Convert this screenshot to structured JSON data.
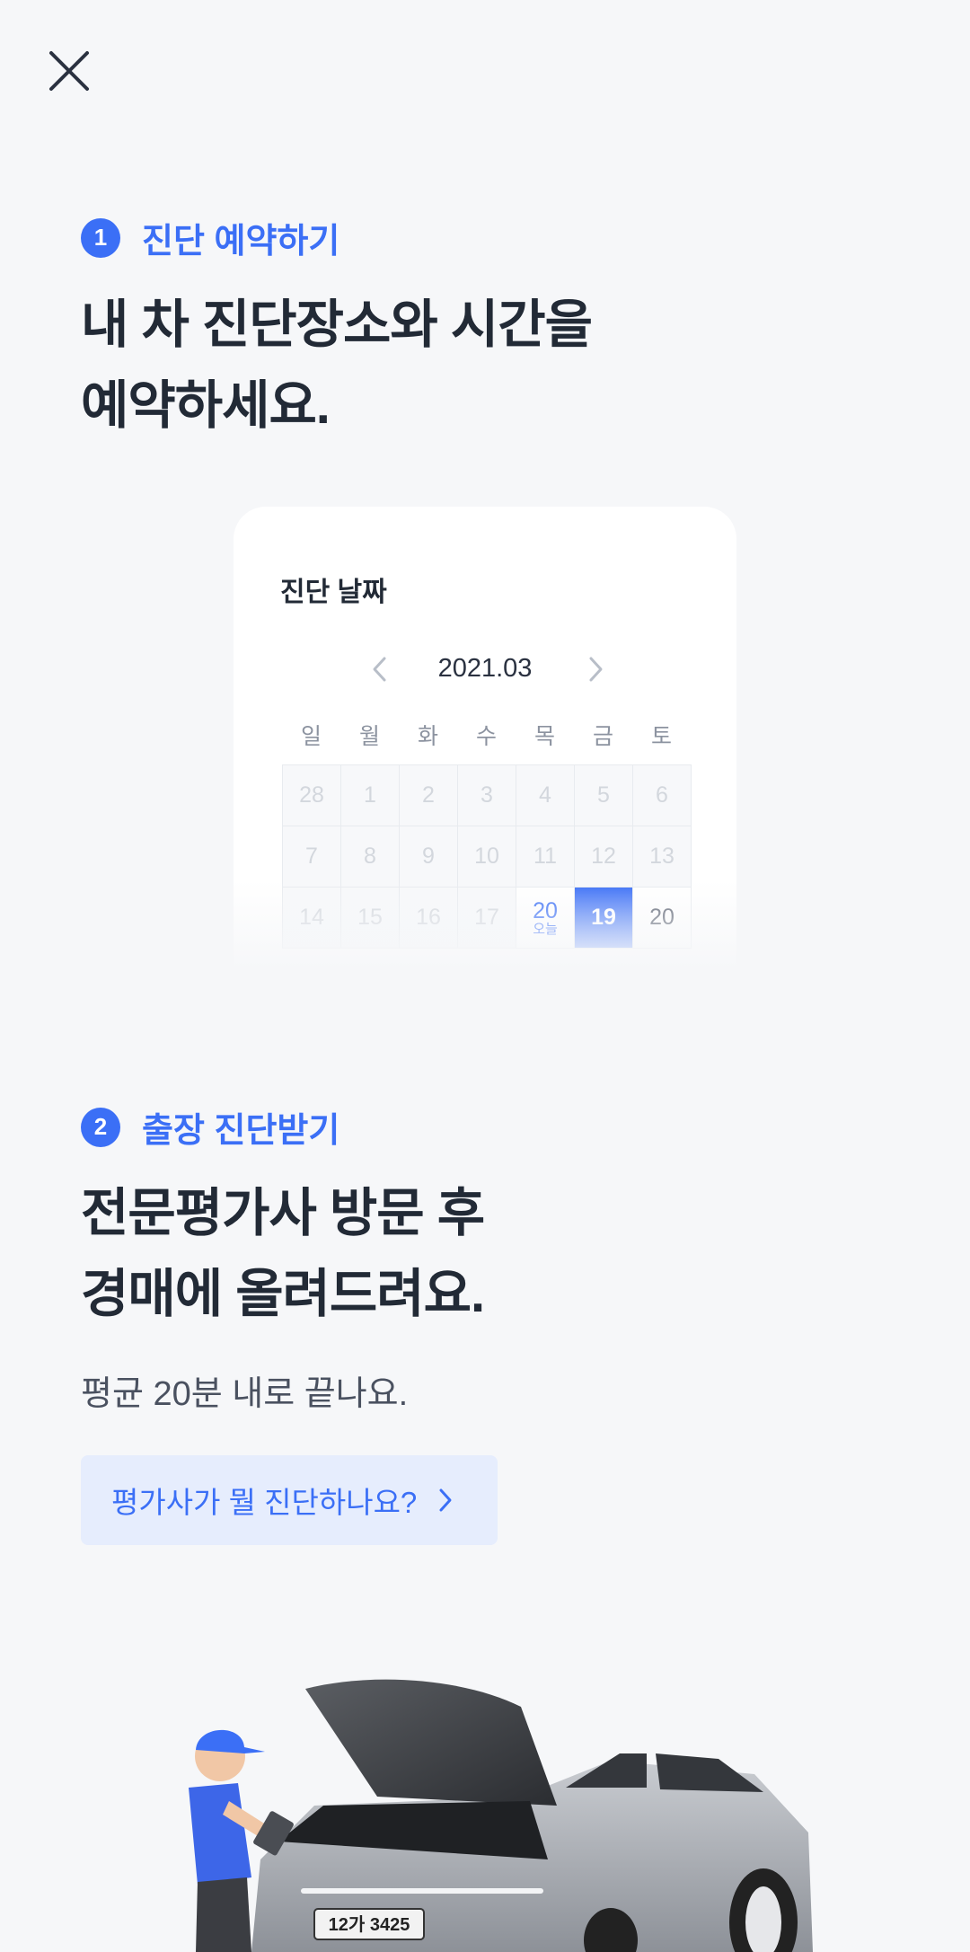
{
  "step1": {
    "number": "1",
    "title": "진단 예약하기",
    "headline_line1": "내 차 진단장소와 시간을",
    "headline_line2": "예약하세요."
  },
  "calendar": {
    "title": "진단 날짜",
    "month": "2021.03",
    "weekdays": [
      "일",
      "월",
      "화",
      "수",
      "목",
      "금",
      "토"
    ],
    "rows": [
      [
        "28",
        "1",
        "2",
        "3",
        "4",
        "5",
        "6"
      ],
      [
        "7",
        "8",
        "9",
        "10",
        "11",
        "12",
        "13"
      ],
      [
        "14",
        "15",
        "16",
        "17",
        "20",
        "19",
        "20"
      ]
    ],
    "today_label": "오늘",
    "accent_color": "#3b6ff6"
  },
  "step2": {
    "number": "2",
    "title": "출장 진단받기",
    "headline_line1": "전문평가사 방문 후",
    "headline_line2": "경매에 올려드려요.",
    "subtext": "평균 20분 내로 끝나요.",
    "link_label": "평가사가 뭘 진단하나요?"
  },
  "illustration": {
    "plate": "12가 3425"
  },
  "icons": {
    "close": "close-icon",
    "prev": "chevron-left-icon",
    "next": "chevron-right-icon",
    "link_arrow": "chevron-right-icon"
  }
}
